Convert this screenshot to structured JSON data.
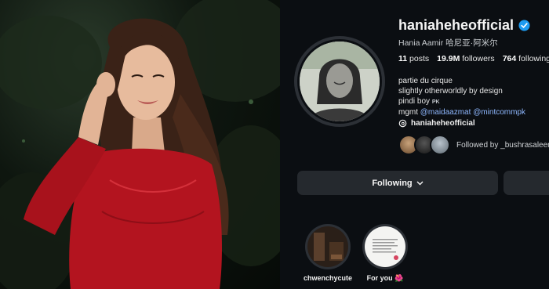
{
  "profile": {
    "username": "haniaheheofficial",
    "full_name": "Hania Aamir 哈尼亚·阿米尔",
    "stats": {
      "posts_count": "11",
      "posts_label": "posts",
      "followers_count": "19.9M",
      "followers_label": "followers",
      "following_count": "764",
      "following_label": "following"
    },
    "bio": {
      "line1": "partie du cirque",
      "line2": "slightly otherworldly by design",
      "line3": "pindi boy",
      "line3_flag": "PK",
      "line4_prefix": "mgmt",
      "mention1": "@maidaazmat",
      "mention2": "@mintcommpk"
    },
    "threads_handle": "haniaheheofficial",
    "followed_by": "Followed by _bushrasaleem"
  },
  "actions": {
    "following_label": "Following",
    "following_caret": "⌄"
  },
  "highlights": [
    {
      "label": "chwenchycute"
    },
    {
      "label": "For you",
      "emoji": "🌺"
    }
  ],
  "icons": {
    "verified": "verified-badge-icon",
    "threads": "threads-icon",
    "caret": "chevron-down-icon"
  },
  "colors": {
    "panel_bg": "#0b0e12",
    "button_bg": "#25292e",
    "link": "#8fb8ff",
    "verified": "#1d9bf0",
    "dress_red": "#b3141f"
  }
}
